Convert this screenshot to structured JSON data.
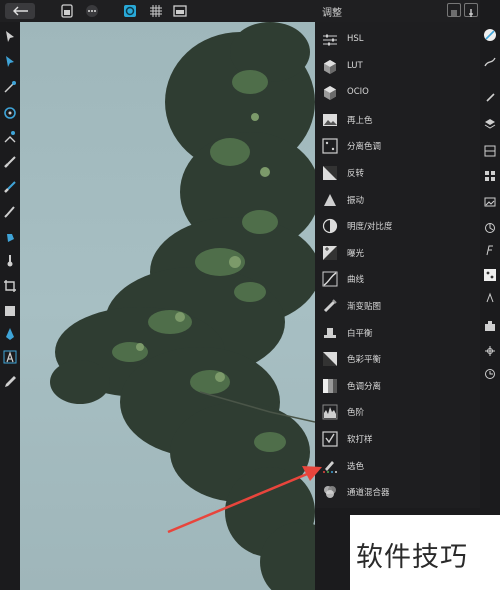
{
  "panel": {
    "title": "调整",
    "items": [
      {
        "label": "HSL",
        "icon": "sliders-icon"
      },
      {
        "label": "LUT",
        "icon": "cube-icon"
      },
      {
        "label": "OCIO",
        "icon": "cube-icon"
      },
      {
        "label": "再上色",
        "icon": "recolor-icon"
      },
      {
        "label": "分离色调",
        "icon": "split-tone-icon"
      },
      {
        "label": "反转",
        "icon": "invert-icon"
      },
      {
        "label": "振动",
        "icon": "triangle-icon"
      },
      {
        "label": "明度/对比度",
        "icon": "half-circle-icon"
      },
      {
        "label": "曝光",
        "icon": "exposure-icon"
      },
      {
        "label": "曲线",
        "icon": "curves-icon"
      },
      {
        "label": "渐变贴图",
        "icon": "gradient-map-icon"
      },
      {
        "label": "白平衡",
        "icon": "white-balance-icon"
      },
      {
        "label": "色彩平衡",
        "icon": "color-balance-icon"
      },
      {
        "label": "色调分离",
        "icon": "posterize-icon"
      },
      {
        "label": "色阶",
        "icon": "levels-icon"
      },
      {
        "label": "软打样",
        "icon": "soft-proof-icon"
      },
      {
        "label": "选色",
        "icon": "selective-color-icon"
      },
      {
        "label": "通道混合器",
        "icon": "channel-mixer-icon"
      }
    ]
  },
  "watermark": {
    "text": "软件技巧"
  },
  "colors": {
    "accent": "#4fc3e8",
    "arrow": "#e8453c",
    "panel_bg": "#1e1e20"
  }
}
